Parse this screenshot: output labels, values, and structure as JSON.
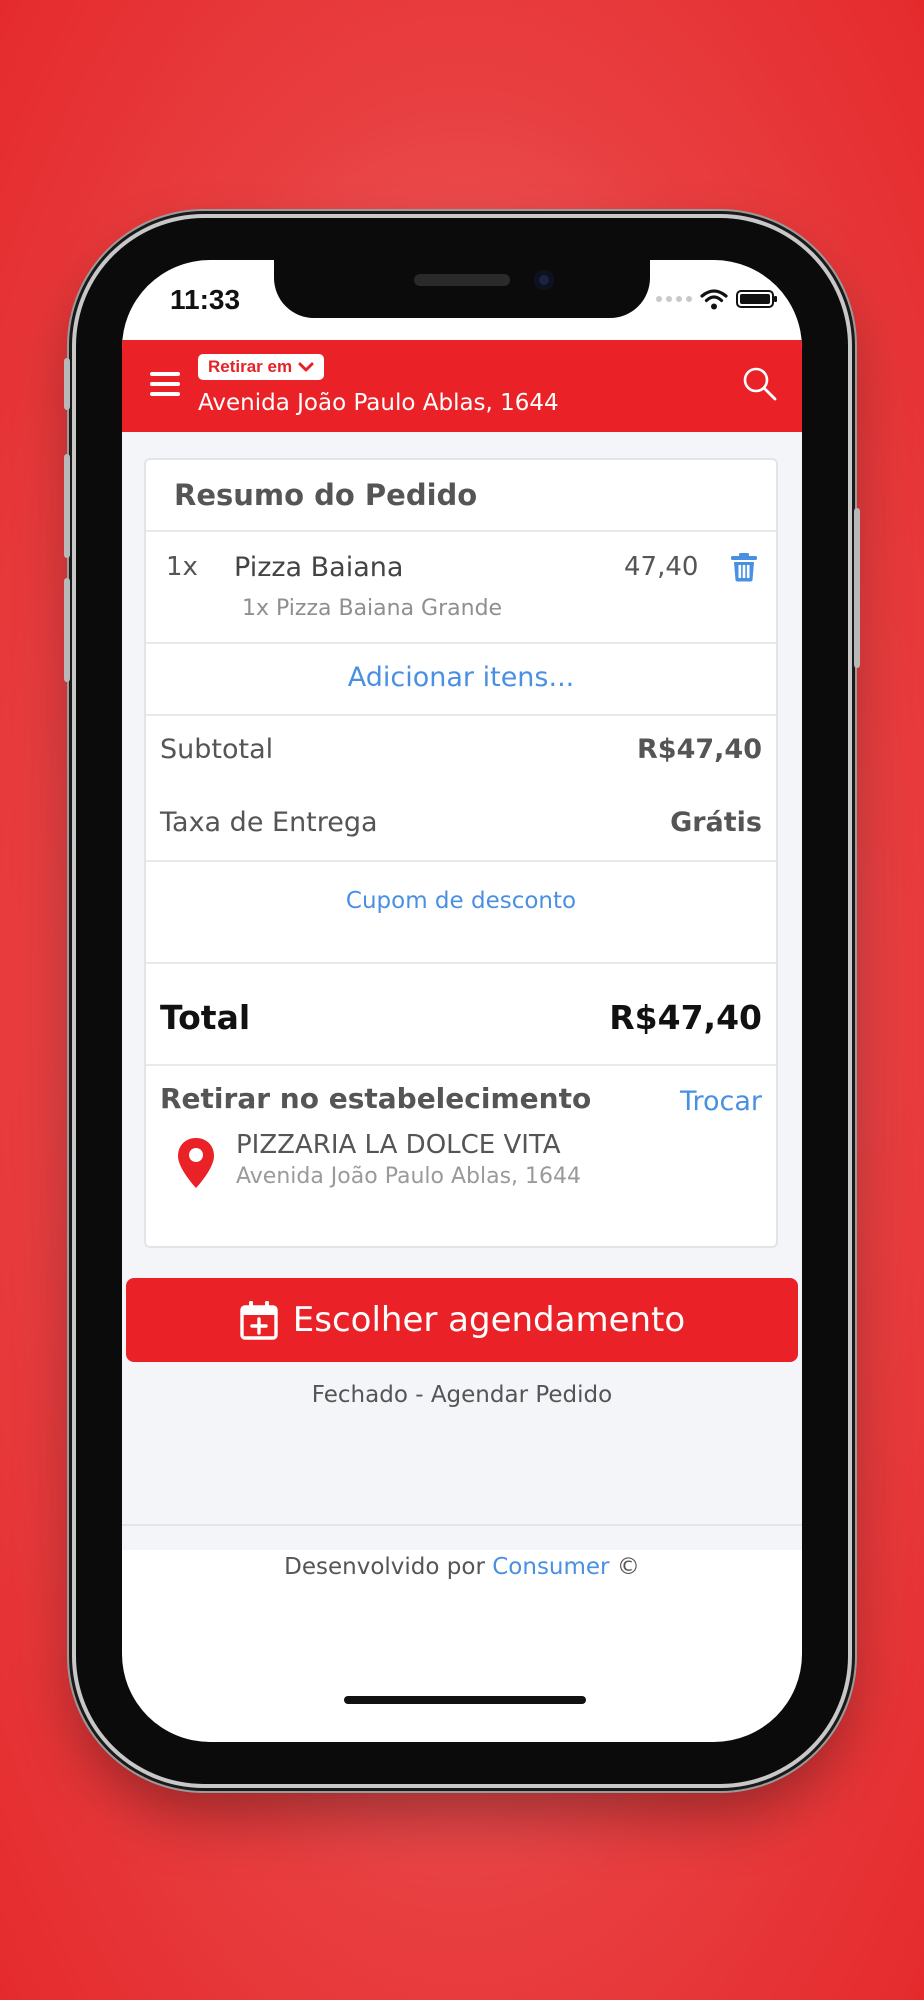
{
  "status_bar": {
    "time": "11:33"
  },
  "header": {
    "pickup_label": "Retirar em",
    "address": "Avenida João Paulo Ablas, 1644",
    "accent_color": "#ea2227"
  },
  "order": {
    "title": "Resumo do Pedido",
    "items": [
      {
        "qty": "1x",
        "name": "Pizza Baiana",
        "price": "47,40",
        "detail": "1x Pizza Baiana Grande"
      }
    ],
    "add_items_label": "Adicionar itens...",
    "subtotal_label": "Subtotal",
    "subtotal_value": "R$47,40",
    "delivery_label": "Taxa de Entrega",
    "delivery_value": "Grátis",
    "coupon_label": "Cupom de desconto",
    "total_label": "Total",
    "total_value": "R$47,40",
    "pickup_title": "Retirar no estabelecimento",
    "swap_label": "Trocar",
    "store_name": "PIZZARIA LA DOLCE VITA",
    "store_address": "Avenida João Paulo Ablas, 1644"
  },
  "schedule_button_label": "Escolher agendamento",
  "closed_text": "Fechado - Agendar Pedido",
  "footer": {
    "prefix": "Desenvolvido por",
    "brand": "Consumer",
    "suffix": "©"
  },
  "icons": [
    "menu-icon",
    "chevron-down-icon",
    "search-icon",
    "trash-icon",
    "map-pin-icon",
    "calendar-plus-icon",
    "wifi-icon",
    "battery-icon"
  ]
}
